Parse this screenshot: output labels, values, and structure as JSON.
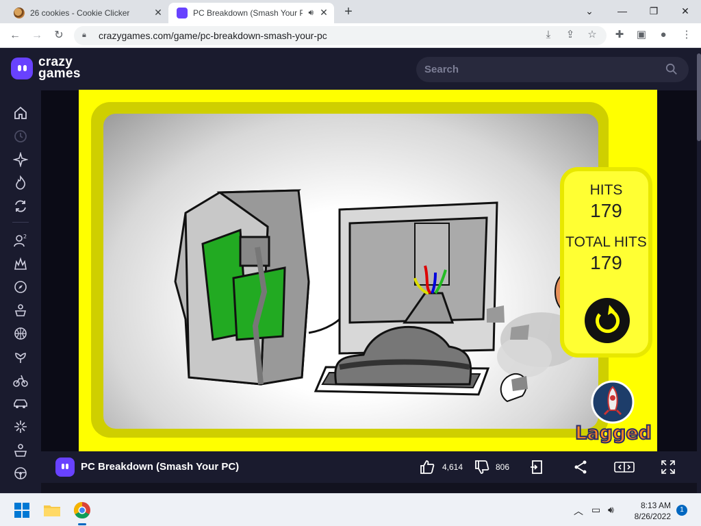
{
  "browser": {
    "tabs": [
      {
        "title": "26 cookies - Cookie Clicker",
        "active": false
      },
      {
        "title": "PC Breakdown (Smash Your PC)",
        "active": true
      }
    ],
    "new_tab_label": "+",
    "url": "crazygames.com/game/pc-breakdown-smash-your-pc",
    "window_controls": [
      "chevron-down",
      "minimize",
      "restore",
      "close"
    ]
  },
  "site": {
    "logo_line1": "crazy",
    "logo_line2": "games",
    "search_placeholder": "Search",
    "sidebar_icons": [
      "home-icon",
      "clock-icon",
      "sparkle-icon",
      "fire-icon",
      "refresh-icon",
      "multiplayer-icon",
      "action-icon",
      "compass-icon",
      "adventure-icon",
      "basketball-icon",
      "flower-icon",
      "bike-icon",
      "car-icon",
      "star-burst-icon",
      "puzzle-icon",
      "steering-wheel-icon"
    ]
  },
  "game": {
    "hits_label": "HITS",
    "hits_value": "179",
    "total_hits_label": "TOTAL HITS",
    "total_hits_value": "179",
    "publisher_logo_text": "Lagged",
    "colors": {
      "background": "#ffff00",
      "panel": "#ffff33",
      "frame": "#cfcf00"
    }
  },
  "infobar": {
    "title": "PC Breakdown (Smash Your PC)",
    "likes": "4,614",
    "dislikes": "806"
  },
  "taskbar": {
    "time": "8:13 AM",
    "date": "8/26/2022",
    "notifications": "1"
  }
}
